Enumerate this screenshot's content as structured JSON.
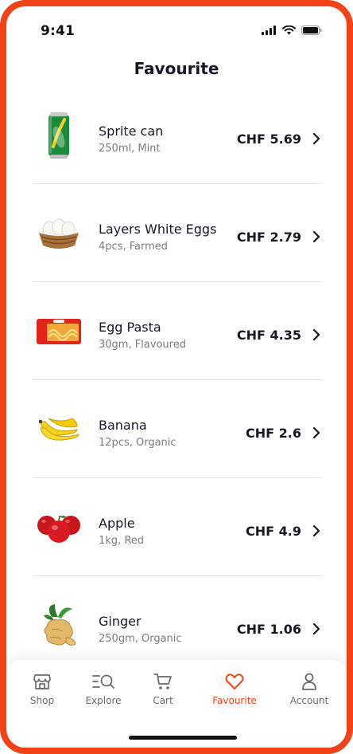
{
  "status": {
    "time": "9:41"
  },
  "header": {
    "title": "Favourite"
  },
  "items": [
    {
      "name": "Sprite can",
      "desc": "250ml, Mint",
      "price": "CHF 5.69",
      "icon": "sprite-can-icon"
    },
    {
      "name": "Layers White Eggs",
      "desc": "4pcs, Farmed",
      "price": "CHF 2.79",
      "icon": "eggs-basket-icon"
    },
    {
      "name": "Egg Pasta",
      "desc": "30gm, Flavoured",
      "price": "CHF 4.35",
      "icon": "pasta-pack-icon"
    },
    {
      "name": "Banana",
      "desc": "12pcs, Organic",
      "price": "CHF 2.6",
      "icon": "banana-icon"
    },
    {
      "name": "Apple",
      "desc": "1kg, Red",
      "price": "CHF 4.9",
      "icon": "apple-icon"
    },
    {
      "name": "Ginger",
      "desc": "250gm, Organic",
      "price": "CHF 1.06",
      "icon": "ginger-icon"
    }
  ],
  "tabs": [
    {
      "label": "Shop",
      "icon": "shop-icon",
      "active": false
    },
    {
      "label": "Explore",
      "icon": "explore-icon",
      "active": false
    },
    {
      "label": "Cart",
      "icon": "cart-icon",
      "active": false
    },
    {
      "label": "Favourite",
      "icon": "heart-icon",
      "active": true
    },
    {
      "label": "Account",
      "icon": "account-icon",
      "active": false
    }
  ],
  "colors": {
    "accent": "#f2421a",
    "text": "#181725",
    "muted": "#7c7c7c",
    "divider": "#e2e2e2"
  }
}
